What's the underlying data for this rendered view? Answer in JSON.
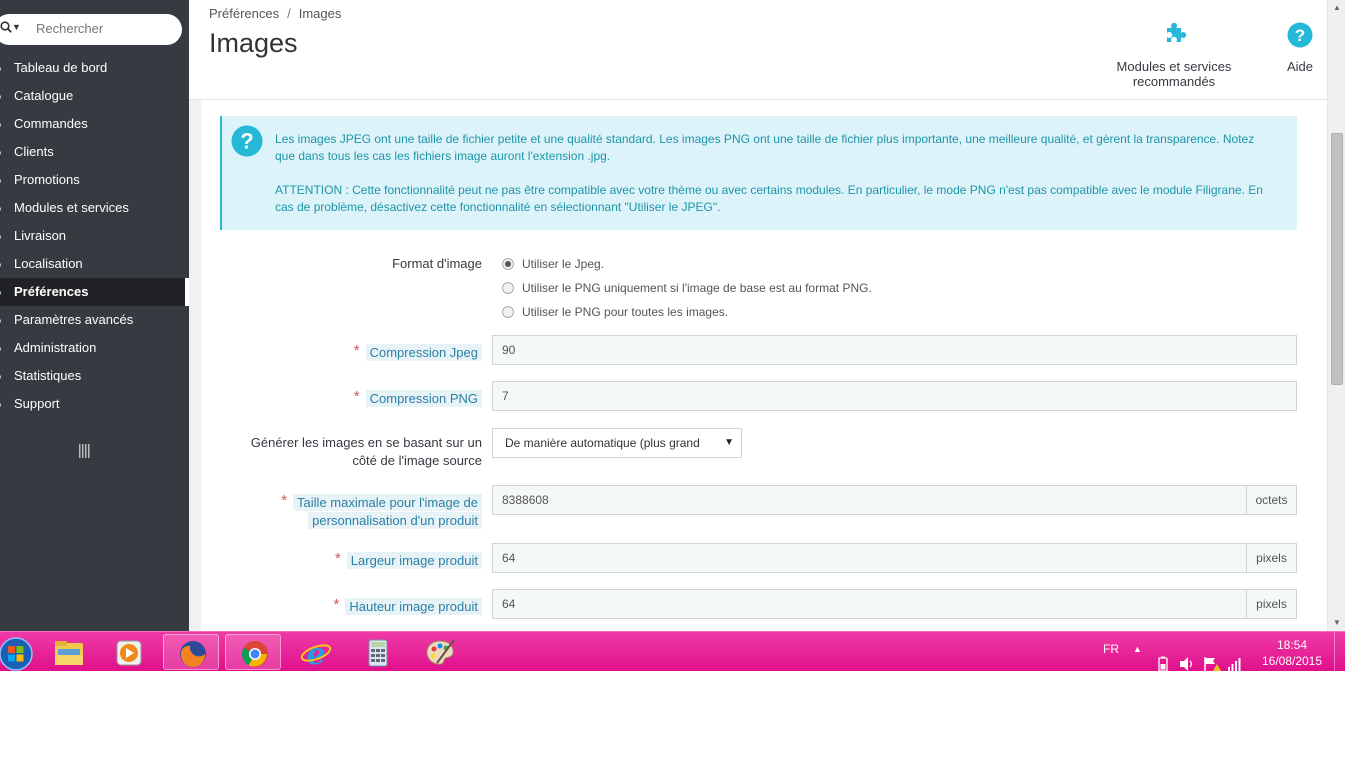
{
  "sidebar": {
    "search_placeholder": "Rechercher",
    "items": [
      {
        "label": "Tableau de bord"
      },
      {
        "label": "Catalogue"
      },
      {
        "label": "Commandes"
      },
      {
        "label": "Clients"
      },
      {
        "label": "Promotions"
      },
      {
        "label": "Modules et services"
      },
      {
        "label": "Livraison"
      },
      {
        "label": "Localisation"
      },
      {
        "label": "Préférences",
        "active": true
      },
      {
        "label": "Paramètres avancés"
      },
      {
        "label": "Administration"
      },
      {
        "label": "Statistiques"
      },
      {
        "label": "Support"
      }
    ]
  },
  "header": {
    "breadcrumb": [
      "Préférences",
      "Images"
    ],
    "breadcrumb_sep": "/",
    "title": "Images",
    "modules_label": "Modules et services recommandés",
    "help_label": "Aide"
  },
  "alert": {
    "para1": "Les images JPEG ont une taille de fichier petite et une qualité standard. Les images PNG ont une taille de fichier plus importante, une meilleure qualité, et gèrent la transparence. Notez que dans tous les cas les fichiers image auront l'extension .jpg.",
    "para2": "ATTENTION : Cette fonctionnalité peut ne pas être compatible avec votre thème ou avec certains modules. En particulier, le mode PNG n'est pas compatible avec le module Filigrane. En cas de problème, désactivez cette fonctionnalité en sélectionnant \"Utiliser le JPEG\"."
  },
  "form": {
    "format_label": "Format d'image",
    "format_options": [
      {
        "label": "Utiliser le Jpeg.",
        "checked": true
      },
      {
        "label": "Utiliser le PNG uniquement si l'image de base est au format PNG.",
        "checked": false
      },
      {
        "label": "Utiliser le PNG pour toutes les images.",
        "checked": false
      }
    ],
    "jpeg_label": "Compression Jpeg",
    "jpeg_value": "90",
    "png_label": "Compression PNG",
    "png_value": "7",
    "generate_label_line1": "Générer les images en se basant sur un",
    "generate_label_line2": "côté de l'image source",
    "generate_value": "De manière automatique (plus grand",
    "maxsize_label_line1": "Taille maximale pour l'image de",
    "maxsize_label_line2": "personnalisation d'un produit",
    "maxsize_value": "8388608",
    "maxsize_unit": "octets",
    "width_label": "Largeur image produit",
    "width_value": "64",
    "width_unit": "pixels",
    "height_label": "Hauteur image produit",
    "height_value": "64",
    "height_unit": "pixels",
    "required_mark": "*"
  },
  "taskbar": {
    "apps": [
      "windows-start",
      "file-explorer",
      "media-player",
      "firefox",
      "chrome",
      "internet-explorer",
      "calculator",
      "paint"
    ],
    "language": "FR",
    "time": "18:54",
    "date": "16/08/2015",
    "accent_color": "#e6179a"
  },
  "colors": {
    "sidebar_bg": "#363a41",
    "alert_bg": "#dcf4f9",
    "alert_text": "#1e94ab",
    "icon_blue": "#25b9d7"
  }
}
